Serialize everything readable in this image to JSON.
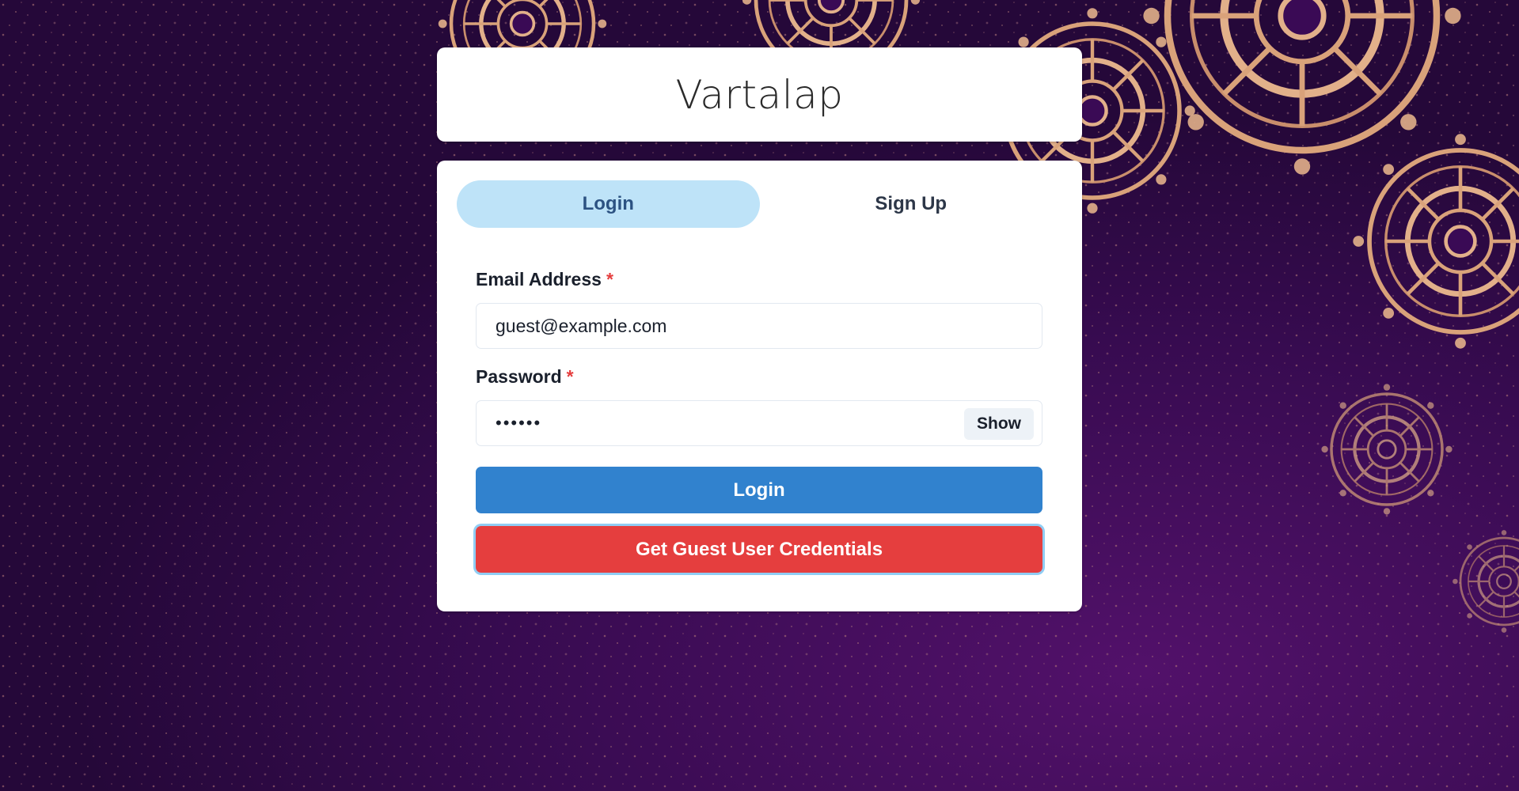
{
  "app": {
    "title": "Vartalap"
  },
  "tabs": [
    {
      "label": "Login",
      "active": true
    },
    {
      "label": "Sign Up",
      "active": false
    }
  ],
  "form": {
    "email": {
      "label": "Email Address",
      "required_mark": "*",
      "value": "guest@example.com"
    },
    "password": {
      "label": "Password",
      "required_mark": "*",
      "value_masked": "••••••",
      "toggle_label": "Show"
    },
    "login_button": "Login",
    "guest_button": "Get Guest User Credentials"
  },
  "colors": {
    "background": "#2c0a45",
    "ornament": "#d9a27a",
    "active_tab": "#bee3f8",
    "login_button": "#3182ce",
    "guest_button": "#e53e3e",
    "required": "#e53e3e"
  },
  "decorations": [
    "mandala-ornament",
    "speckle-dots"
  ]
}
